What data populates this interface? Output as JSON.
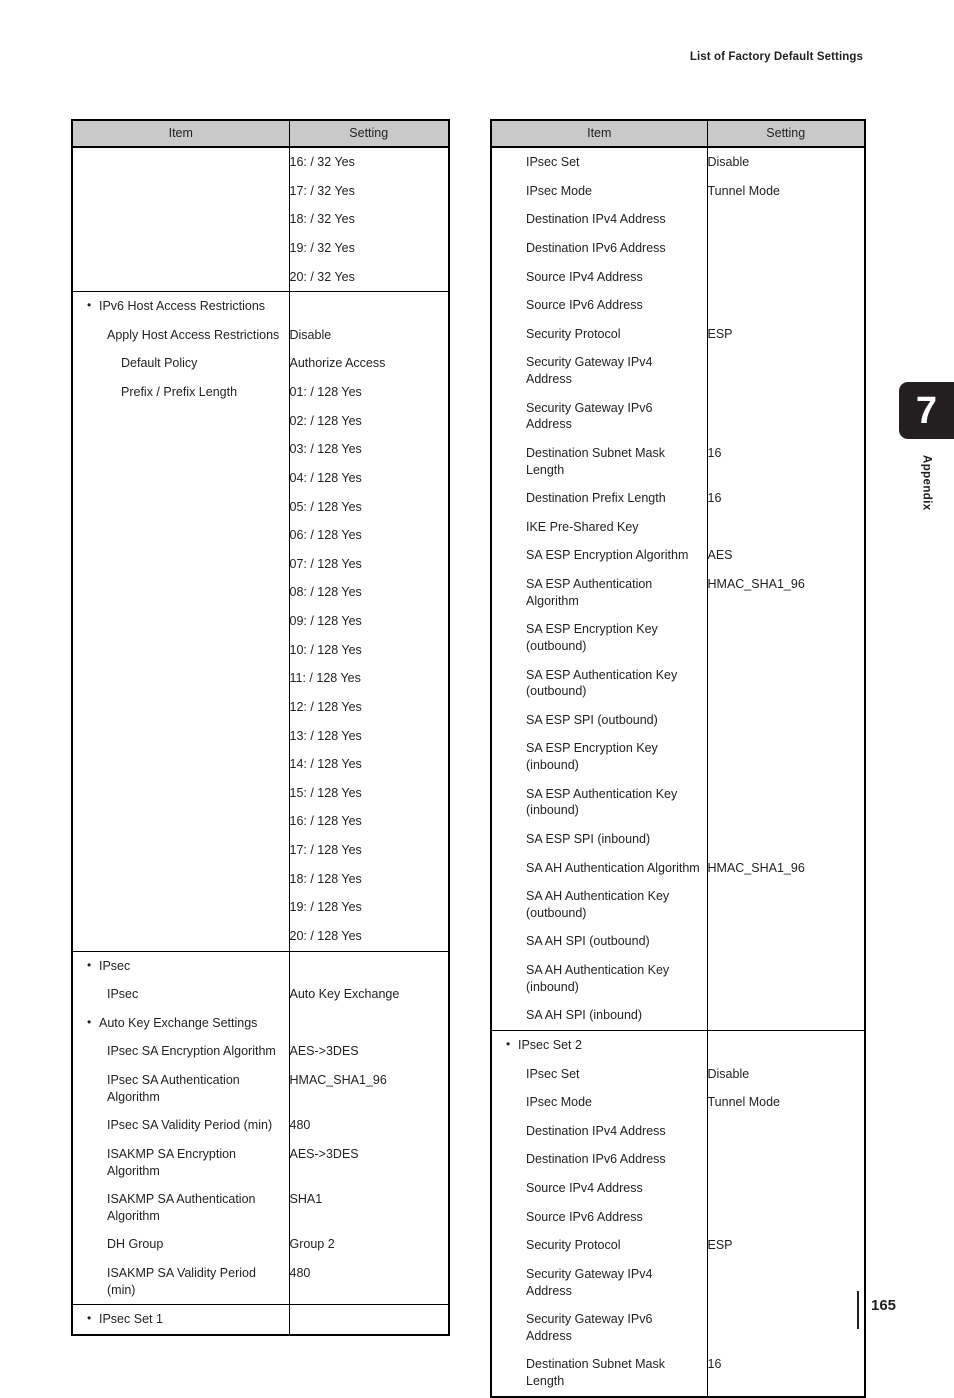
{
  "header": {
    "running_title": "List of Factory Default Settings"
  },
  "chapter_tab": {
    "number": "7",
    "label": "Appendix"
  },
  "footer": {
    "page_number": "165"
  },
  "columns": {
    "item": "Item",
    "setting": "Setting"
  },
  "left_table": {
    "rows": [
      {
        "item": "",
        "setting": "16: / 32 Yes",
        "level": "none"
      },
      {
        "item": "",
        "setting": "17: / 32 Yes",
        "level": "none"
      },
      {
        "item": "",
        "setting": "18: / 32 Yes",
        "level": "none"
      },
      {
        "item": "",
        "setting": "19: / 32 Yes",
        "level": "none"
      },
      {
        "item": "",
        "setting": "20: / 32 Yes",
        "level": "none"
      },
      {
        "item": "IPv6 Host Access Restrictions",
        "setting": "",
        "level": "bullet",
        "section_start": true
      },
      {
        "item": "Apply Host Access Restrictions",
        "setting": "Disable",
        "level": "lvl-1"
      },
      {
        "item": "Default Policy",
        "setting": "Authorize Access",
        "level": "lvl-2"
      },
      {
        "item": "Prefix / Prefix Length",
        "setting": "01: / 128 Yes",
        "level": "lvl-2"
      },
      {
        "item": "",
        "setting": "02: / 128 Yes",
        "level": "none"
      },
      {
        "item": "",
        "setting": "03: / 128 Yes",
        "level": "none"
      },
      {
        "item": "",
        "setting": "04: / 128 Yes",
        "level": "none"
      },
      {
        "item": "",
        "setting": "05: / 128 Yes",
        "level": "none"
      },
      {
        "item": "",
        "setting": "06: / 128 Yes",
        "level": "none"
      },
      {
        "item": "",
        "setting": "07: / 128 Yes",
        "level": "none"
      },
      {
        "item": "",
        "setting": "08: / 128 Yes",
        "level": "none"
      },
      {
        "item": "",
        "setting": "09: / 128 Yes",
        "level": "none"
      },
      {
        "item": "",
        "setting": "10: / 128 Yes",
        "level": "none"
      },
      {
        "item": "",
        "setting": "11: / 128 Yes",
        "level": "none"
      },
      {
        "item": "",
        "setting": "12: / 128 Yes",
        "level": "none"
      },
      {
        "item": "",
        "setting": "13: / 128 Yes",
        "level": "none"
      },
      {
        "item": "",
        "setting": "14: / 128 Yes",
        "level": "none"
      },
      {
        "item": "",
        "setting": "15: / 128 Yes",
        "level": "none"
      },
      {
        "item": "",
        "setting": "16: / 128 Yes",
        "level": "none"
      },
      {
        "item": "",
        "setting": "17: / 128 Yes",
        "level": "none"
      },
      {
        "item": "",
        "setting": "18: / 128 Yes",
        "level": "none"
      },
      {
        "item": "",
        "setting": "19: / 128 Yes",
        "level": "none"
      },
      {
        "item": "",
        "setting": "20: / 128 Yes",
        "level": "none"
      },
      {
        "item": "IPsec",
        "setting": "",
        "level": "bullet",
        "section_start": true
      },
      {
        "item": "IPsec",
        "setting": "Auto Key Exchange",
        "level": "lvl-1"
      },
      {
        "item": "Auto Key Exchange Settings",
        "setting": "",
        "level": "bullet"
      },
      {
        "item": "IPsec SA Encryption Algorithm",
        "setting": "AES->3DES",
        "level": "lvl-1"
      },
      {
        "item": "IPsec SA Authentication Algorithm",
        "setting": "HMAC_SHA1_96",
        "level": "lvl-1"
      },
      {
        "item": "IPsec SA Validity Period (min)",
        "setting": "480",
        "level": "lvl-1"
      },
      {
        "item": "ISAKMP SA Encryption Algorithm",
        "setting": "AES->3DES",
        "level": "lvl-1"
      },
      {
        "item": "ISAKMP SA Authentication Algorithm",
        "setting": "SHA1",
        "level": "lvl-1"
      },
      {
        "item": "DH Group",
        "setting": "Group 2",
        "level": "lvl-1"
      },
      {
        "item": "ISAKMP SA Validity Period (min)",
        "setting": "480",
        "level": "lvl-1"
      },
      {
        "item": "IPsec Set 1",
        "setting": "",
        "level": "bullet",
        "section_start": true
      }
    ]
  },
  "right_table": {
    "rows": [
      {
        "item": "IPsec Set",
        "setting": "Disable",
        "level": "lvl-1"
      },
      {
        "item": "IPsec Mode",
        "setting": "Tunnel Mode",
        "level": "lvl-1"
      },
      {
        "item": "Destination IPv4 Address",
        "setting": "",
        "level": "lvl-1"
      },
      {
        "item": "Destination IPv6 Address",
        "setting": "",
        "level": "lvl-1"
      },
      {
        "item": "Source IPv4 Address",
        "setting": "",
        "level": "lvl-1"
      },
      {
        "item": "Source IPv6 Address",
        "setting": "",
        "level": "lvl-1"
      },
      {
        "item": "Security Protocol",
        "setting": "ESP",
        "level": "lvl-1"
      },
      {
        "item": "Security Gateway IPv4 Address",
        "setting": "",
        "level": "lvl-1"
      },
      {
        "item": "Security Gateway IPv6 Address",
        "setting": "",
        "level": "lvl-1"
      },
      {
        "item": "Destination Subnet Mask Length",
        "setting": "16",
        "level": "lvl-1"
      },
      {
        "item": "Destination Prefix Length",
        "setting": "16",
        "level": "lvl-1"
      },
      {
        "item": "IKE Pre-Shared Key",
        "setting": "",
        "level": "lvl-1"
      },
      {
        "item": "SA ESP Encryption Algorithm",
        "setting": "AES",
        "level": "lvl-1"
      },
      {
        "item": "SA ESP Authentication Algorithm",
        "setting": "HMAC_SHA1_96",
        "level": "lvl-1"
      },
      {
        "item": "SA ESP Encryption Key (outbound)",
        "setting": "",
        "level": "lvl-1"
      },
      {
        "item": "SA ESP Authentication Key (outbound)",
        "setting": "",
        "level": "lvl-1"
      },
      {
        "item": "SA ESP SPI (outbound)",
        "setting": "",
        "level": "lvl-1"
      },
      {
        "item": "SA ESP Encryption Key (inbound)",
        "setting": "",
        "level": "lvl-1"
      },
      {
        "item": "SA ESP Authentication Key (inbound)",
        "setting": "",
        "level": "lvl-1"
      },
      {
        "item": "SA ESP SPI (inbound)",
        "setting": "",
        "level": "lvl-1"
      },
      {
        "item": "SA AH Authentication Algorithm",
        "setting": "HMAC_SHA1_96",
        "level": "lvl-1"
      },
      {
        "item": "SA AH Authentication Key (outbound)",
        "setting": "",
        "level": "lvl-1"
      },
      {
        "item": "SA AH SPI (outbound)",
        "setting": "",
        "level": "lvl-1"
      },
      {
        "item": "SA AH Authentication Key (inbound)",
        "setting": "",
        "level": "lvl-1"
      },
      {
        "item": "SA AH SPI (inbound)",
        "setting": "",
        "level": "lvl-1"
      },
      {
        "item": "IPsec Set 2",
        "setting": "",
        "level": "bullet",
        "section_start": true
      },
      {
        "item": "IPsec Set",
        "setting": "Disable",
        "level": "lvl-1"
      },
      {
        "item": "IPsec Mode",
        "setting": "Tunnel Mode",
        "level": "lvl-1"
      },
      {
        "item": "Destination IPv4 Address",
        "setting": "",
        "level": "lvl-1"
      },
      {
        "item": "Destination IPv6 Address",
        "setting": "",
        "level": "lvl-1"
      },
      {
        "item": "Source IPv4 Address",
        "setting": "",
        "level": "lvl-1"
      },
      {
        "item": "Source IPv6 Address",
        "setting": "",
        "level": "lvl-1"
      },
      {
        "item": "Security Protocol",
        "setting": "ESP",
        "level": "lvl-1"
      },
      {
        "item": "Security Gateway IPv4 Address",
        "setting": "",
        "level": "lvl-1"
      },
      {
        "item": "Security Gateway IPv6 Address",
        "setting": "",
        "level": "lvl-1"
      },
      {
        "item": "Destination Subnet Mask Length",
        "setting": "16",
        "level": "lvl-1"
      }
    ]
  }
}
